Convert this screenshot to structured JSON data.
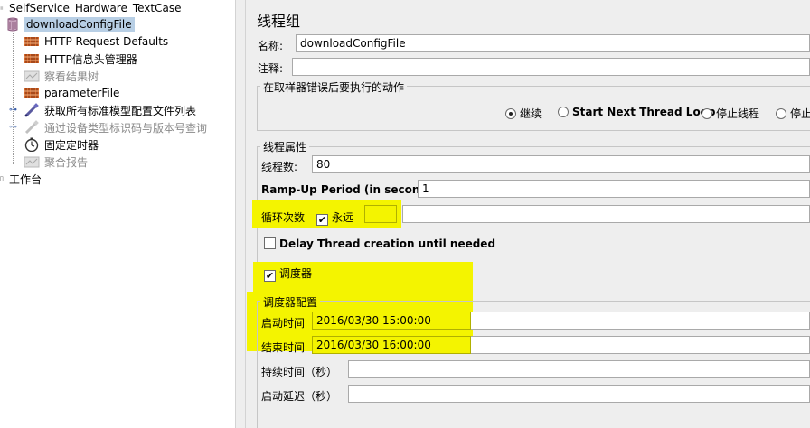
{
  "tree": {
    "items": [
      {
        "label": "SelfService_Hardware_TextCase",
        "icon": "test-plan-icon"
      },
      {
        "label": "downloadConfigFile",
        "icon": "thread-group-icon"
      },
      {
        "label": "HTTP Request Defaults",
        "icon": "config-element-icon"
      },
      {
        "label": "HTTP信息头管理器",
        "icon": "config-element-icon"
      },
      {
        "label": "察看结果树",
        "icon": "listener-icon"
      },
      {
        "label": "parameterFile",
        "icon": "config-element-icon"
      },
      {
        "label": "获取所有标准模型配置文件列表",
        "icon": "sampler-pipette-icon"
      },
      {
        "label": "通过设备类型标识码与版本号查询",
        "icon": "sampler-pipette-icon"
      },
      {
        "label": "固定定时器",
        "icon": "timer-icon"
      },
      {
        "label": "聚合报告",
        "icon": "listener-icon"
      },
      {
        "label": "工作台",
        "icon": "workbench-icon"
      }
    ]
  },
  "panel": {
    "title": "线程组",
    "name_label": "名称:",
    "name_value": "downloadConfigFile",
    "comment_label": "注释:",
    "comment_value": "",
    "error_group_title": "在取样器错误后要执行的动作",
    "error_options": [
      "继续",
      "Start Next Thread Loop",
      "停止线程",
      "停止"
    ],
    "error_selected": "继续",
    "thread_props_title": "线程属性",
    "threads_label": "线程数:",
    "threads_value": "80",
    "rampup_label": "Ramp-Up Period (in seconds):",
    "rampup_value": "1",
    "loop_label": "循环次数",
    "forever_label": "永远",
    "forever_checked": true,
    "delay_label": "Delay Thread creation until needed",
    "delay_checked": false,
    "scheduler_label": "调度器",
    "scheduler_checked": true,
    "scheduler_config_title": "调度器配置",
    "start_time_label": "启动时间",
    "start_time_value": "2016/03/30 15:00:00",
    "end_time_label": "结束时间",
    "end_time_value": "2016/03/30 16:00:00",
    "duration_label": "持续时间（秒）",
    "duration_value": "",
    "startup_delay_label": "启动延迟（秒）",
    "startup_delay_value": ""
  },
  "colors": {
    "highlight": "#f4f400",
    "selection": "#b8cfe5",
    "background": "#eeeeee"
  }
}
